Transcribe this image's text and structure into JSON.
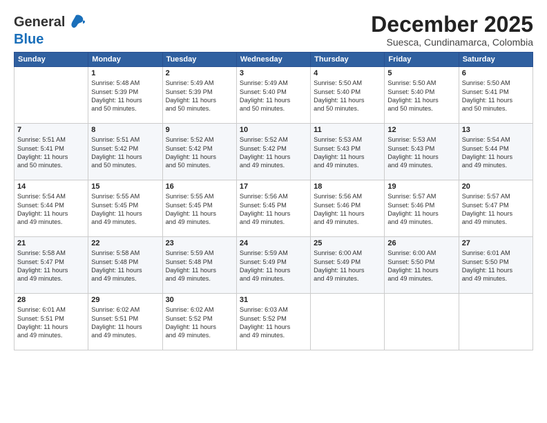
{
  "header": {
    "logo_line1": "General",
    "logo_line2": "Blue",
    "title": "December 2025",
    "subtitle": "Suesca, Cundinamarca, Colombia"
  },
  "calendar": {
    "columns": [
      "Sunday",
      "Monday",
      "Tuesday",
      "Wednesday",
      "Thursday",
      "Friday",
      "Saturday"
    ],
    "weeks": [
      [
        {
          "day": "",
          "sunrise": "",
          "sunset": "",
          "daylight": ""
        },
        {
          "day": "1",
          "sunrise": "Sunrise: 5:48 AM",
          "sunset": "Sunset: 5:39 PM",
          "daylight": "Daylight: 11 hours and 50 minutes."
        },
        {
          "day": "2",
          "sunrise": "Sunrise: 5:49 AM",
          "sunset": "Sunset: 5:39 PM",
          "daylight": "Daylight: 11 hours and 50 minutes."
        },
        {
          "day": "3",
          "sunrise": "Sunrise: 5:49 AM",
          "sunset": "Sunset: 5:40 PM",
          "daylight": "Daylight: 11 hours and 50 minutes."
        },
        {
          "day": "4",
          "sunrise": "Sunrise: 5:50 AM",
          "sunset": "Sunset: 5:40 PM",
          "daylight": "Daylight: 11 hours and 50 minutes."
        },
        {
          "day": "5",
          "sunrise": "Sunrise: 5:50 AM",
          "sunset": "Sunset: 5:40 PM",
          "daylight": "Daylight: 11 hours and 50 minutes."
        },
        {
          "day": "6",
          "sunrise": "Sunrise: 5:50 AM",
          "sunset": "Sunset: 5:41 PM",
          "daylight": "Daylight: 11 hours and 50 minutes."
        }
      ],
      [
        {
          "day": "7",
          "sunrise": "Sunrise: 5:51 AM",
          "sunset": "Sunset: 5:41 PM",
          "daylight": "Daylight: 11 hours and 50 minutes."
        },
        {
          "day": "8",
          "sunrise": "Sunrise: 5:51 AM",
          "sunset": "Sunset: 5:42 PM",
          "daylight": "Daylight: 11 hours and 50 minutes."
        },
        {
          "day": "9",
          "sunrise": "Sunrise: 5:52 AM",
          "sunset": "Sunset: 5:42 PM",
          "daylight": "Daylight: 11 hours and 50 minutes."
        },
        {
          "day": "10",
          "sunrise": "Sunrise: 5:52 AM",
          "sunset": "Sunset: 5:42 PM",
          "daylight": "Daylight: 11 hours and 49 minutes."
        },
        {
          "day": "11",
          "sunrise": "Sunrise: 5:53 AM",
          "sunset": "Sunset: 5:43 PM",
          "daylight": "Daylight: 11 hours and 49 minutes."
        },
        {
          "day": "12",
          "sunrise": "Sunrise: 5:53 AM",
          "sunset": "Sunset: 5:43 PM",
          "daylight": "Daylight: 11 hours and 49 minutes."
        },
        {
          "day": "13",
          "sunrise": "Sunrise: 5:54 AM",
          "sunset": "Sunset: 5:44 PM",
          "daylight": "Daylight: 11 hours and 49 minutes."
        }
      ],
      [
        {
          "day": "14",
          "sunrise": "Sunrise: 5:54 AM",
          "sunset": "Sunset: 5:44 PM",
          "daylight": "Daylight: 11 hours and 49 minutes."
        },
        {
          "day": "15",
          "sunrise": "Sunrise: 5:55 AM",
          "sunset": "Sunset: 5:45 PM",
          "daylight": "Daylight: 11 hours and 49 minutes."
        },
        {
          "day": "16",
          "sunrise": "Sunrise: 5:55 AM",
          "sunset": "Sunset: 5:45 PM",
          "daylight": "Daylight: 11 hours and 49 minutes."
        },
        {
          "day": "17",
          "sunrise": "Sunrise: 5:56 AM",
          "sunset": "Sunset: 5:45 PM",
          "daylight": "Daylight: 11 hours and 49 minutes."
        },
        {
          "day": "18",
          "sunrise": "Sunrise: 5:56 AM",
          "sunset": "Sunset: 5:46 PM",
          "daylight": "Daylight: 11 hours and 49 minutes."
        },
        {
          "day": "19",
          "sunrise": "Sunrise: 5:57 AM",
          "sunset": "Sunset: 5:46 PM",
          "daylight": "Daylight: 11 hours and 49 minutes."
        },
        {
          "day": "20",
          "sunrise": "Sunrise: 5:57 AM",
          "sunset": "Sunset: 5:47 PM",
          "daylight": "Daylight: 11 hours and 49 minutes."
        }
      ],
      [
        {
          "day": "21",
          "sunrise": "Sunrise: 5:58 AM",
          "sunset": "Sunset: 5:47 PM",
          "daylight": "Daylight: 11 hours and 49 minutes."
        },
        {
          "day": "22",
          "sunrise": "Sunrise: 5:58 AM",
          "sunset": "Sunset: 5:48 PM",
          "daylight": "Daylight: 11 hours and 49 minutes."
        },
        {
          "day": "23",
          "sunrise": "Sunrise: 5:59 AM",
          "sunset": "Sunset: 5:48 PM",
          "daylight": "Daylight: 11 hours and 49 minutes."
        },
        {
          "day": "24",
          "sunrise": "Sunrise: 5:59 AM",
          "sunset": "Sunset: 5:49 PM",
          "daylight": "Daylight: 11 hours and 49 minutes."
        },
        {
          "day": "25",
          "sunrise": "Sunrise: 6:00 AM",
          "sunset": "Sunset: 5:49 PM",
          "daylight": "Daylight: 11 hours and 49 minutes."
        },
        {
          "day": "26",
          "sunrise": "Sunrise: 6:00 AM",
          "sunset": "Sunset: 5:50 PM",
          "daylight": "Daylight: 11 hours and 49 minutes."
        },
        {
          "day": "27",
          "sunrise": "Sunrise: 6:01 AM",
          "sunset": "Sunset: 5:50 PM",
          "daylight": "Daylight: 11 hours and 49 minutes."
        }
      ],
      [
        {
          "day": "28",
          "sunrise": "Sunrise: 6:01 AM",
          "sunset": "Sunset: 5:51 PM",
          "daylight": "Daylight: 11 hours and 49 minutes."
        },
        {
          "day": "29",
          "sunrise": "Sunrise: 6:02 AM",
          "sunset": "Sunset: 5:51 PM",
          "daylight": "Daylight: 11 hours and 49 minutes."
        },
        {
          "day": "30",
          "sunrise": "Sunrise: 6:02 AM",
          "sunset": "Sunset: 5:52 PM",
          "daylight": "Daylight: 11 hours and 49 minutes."
        },
        {
          "day": "31",
          "sunrise": "Sunrise: 6:03 AM",
          "sunset": "Sunset: 5:52 PM",
          "daylight": "Daylight: 11 hours and 49 minutes."
        },
        {
          "day": "",
          "sunrise": "",
          "sunset": "",
          "daylight": ""
        },
        {
          "day": "",
          "sunrise": "",
          "sunset": "",
          "daylight": ""
        },
        {
          "day": "",
          "sunrise": "",
          "sunset": "",
          "daylight": ""
        }
      ]
    ]
  }
}
